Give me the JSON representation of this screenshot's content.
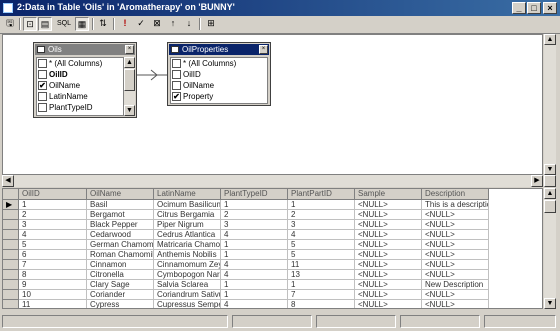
{
  "window": {
    "title": "2:Data in Table 'Oils' in 'Aromatherapy' on 'BUNNY'",
    "minimize": "_",
    "maximize": "□",
    "close": "×"
  },
  "toolbar": {
    "buttons": [
      {
        "name": "properties-icon",
        "glyph": "🖫"
      },
      {
        "name": "diagram-pane-icon",
        "glyph": "⊡"
      },
      {
        "name": "grid-pane-icon",
        "glyph": "▤"
      },
      {
        "name": "sql-pane-icon",
        "glyph": "SQL"
      },
      {
        "name": "results-pane-icon",
        "glyph": "▦"
      },
      {
        "name": "change-query-type-icon",
        "glyph": "⇅"
      },
      {
        "name": "run-icon",
        "glyph": "!"
      },
      {
        "name": "verify-sql-icon",
        "glyph": "✓"
      },
      {
        "name": "remove-filter-icon",
        "glyph": "⊠"
      },
      {
        "name": "sort-ascending-icon",
        "glyph": "↑"
      },
      {
        "name": "sort-descending-icon",
        "glyph": "↓"
      },
      {
        "name": "add-table-icon",
        "glyph": "⊞"
      }
    ]
  },
  "diagram": {
    "tables": [
      {
        "title": "Oils",
        "columns": [
          {
            "label": "* (All Columns)",
            "checked": false,
            "mark": ""
          },
          {
            "label": "OilID",
            "checked": false,
            "mark": "key"
          },
          {
            "label": "OilName",
            "checked": true,
            "mark": "✔"
          },
          {
            "label": "LatinName",
            "checked": false,
            "mark": ""
          },
          {
            "label": "PlantTypeID",
            "checked": false,
            "mark": ""
          }
        ]
      },
      {
        "title": "OilProperties",
        "columns": [
          {
            "label": "* (All Columns)",
            "checked": false,
            "mark": ""
          },
          {
            "label": "OilID",
            "checked": false,
            "mark": ""
          },
          {
            "label": "OilName",
            "checked": false,
            "mark": ""
          },
          {
            "label": "Property",
            "checked": true,
            "mark": "✔"
          }
        ]
      }
    ]
  },
  "grid": {
    "columns": [
      "OilID",
      "OilName",
      "LatinName",
      "PlantTypeID",
      "PlantPartID",
      "Sample",
      "Description"
    ],
    "current_row_indicator": "▶",
    "rows": [
      [
        "1",
        "Basil",
        "Ocimum Basilicum",
        "1",
        "1",
        "<NULL>",
        "This is a description"
      ],
      [
        "2",
        "Bergamot",
        "Citrus Bergamia",
        "2",
        "2",
        "<NULL>",
        "<NULL>"
      ],
      [
        "3",
        "Black Pepper",
        "Piper Nigrum",
        "3",
        "3",
        "<NULL>",
        "<NULL>"
      ],
      [
        "4",
        "Cedarwood",
        "Cedrus Atlantica",
        "4",
        "4",
        "<NULL>",
        "<NULL>"
      ],
      [
        "5",
        "German Chamomile",
        "Matricaria Chamom",
        "1",
        "5",
        "<NULL>",
        "<NULL>"
      ],
      [
        "6",
        "Roman Chamomile",
        "Anthemis Nobilis",
        "1",
        "5",
        "<NULL>",
        "<NULL>"
      ],
      [
        "7",
        "Cinnamon",
        "Cinnamomum Zeyla",
        "4",
        "11",
        "<NULL>",
        "<NULL>"
      ],
      [
        "8",
        "Citronella",
        "Cymbopogon Nard",
        "4",
        "13",
        "<NULL>",
        "<NULL>"
      ],
      [
        "9",
        "Clary Sage",
        "Salvia Sclarea",
        "1",
        "1",
        "<NULL>",
        "New Description"
      ],
      [
        "10",
        "Coriander",
        "Coriandrum Sativu",
        "1",
        "7",
        "<NULL>",
        "<NULL>"
      ],
      [
        "11",
        "Cypress",
        "Cupressus Semper",
        "4",
        "8",
        "<NULL>",
        "<NULL>"
      ]
    ]
  },
  "colors": {
    "title_active": "#0a246a",
    "title_inactive": "#808080",
    "face": "#d4d0c8"
  }
}
